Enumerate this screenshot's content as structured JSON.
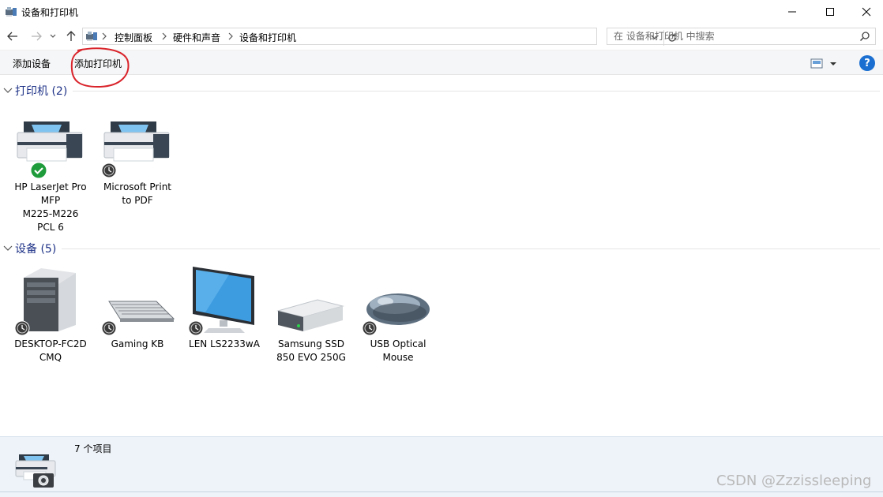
{
  "window": {
    "title": "设备和打印机"
  },
  "address": {
    "breadcrumbs": [
      "控制面板",
      "硬件和声音",
      "设备和打印机"
    ],
    "search_placeholder": "在 设备和打印机 中搜索"
  },
  "commands": {
    "add_device": "添加设备",
    "add_printer": "添加打印机",
    "help": "?"
  },
  "sections": {
    "printers": {
      "label": "打印机 (2)",
      "items": [
        {
          "name": "HP LaserJet Pro\nMFP\nM225-M226\nPCL 6",
          "icon": "printer-icon",
          "status": "default-check"
        },
        {
          "name": "Microsoft Print\nto PDF",
          "icon": "printer-icon",
          "status": "clock"
        }
      ]
    },
    "devices": {
      "label": "设备 (5)",
      "items": [
        {
          "name": "DESKTOP-FC2D\nCMQ",
          "icon": "computer-tower-icon",
          "status": "clock"
        },
        {
          "name": "Gaming KB",
          "icon": "keyboard-icon",
          "status": "clock"
        },
        {
          "name": "LEN LS2233wA",
          "icon": "monitor-icon",
          "status": "clock"
        },
        {
          "name": "Samsung SSD\n850 EVO 250G",
          "icon": "drive-icon",
          "status": "clock"
        },
        {
          "name": "USB Optical\nMouse",
          "icon": "mouse-icon",
          "status": "clock"
        }
      ]
    }
  },
  "status": {
    "item_count": "7 个项目"
  },
  "watermark": "CSDN @Zzzissleeping",
  "colors": {
    "section_header": "#1e3287",
    "accent_blue": "#1a6fd1",
    "annotation_red": "#d9232a",
    "status_bg": "#eef3f9"
  }
}
